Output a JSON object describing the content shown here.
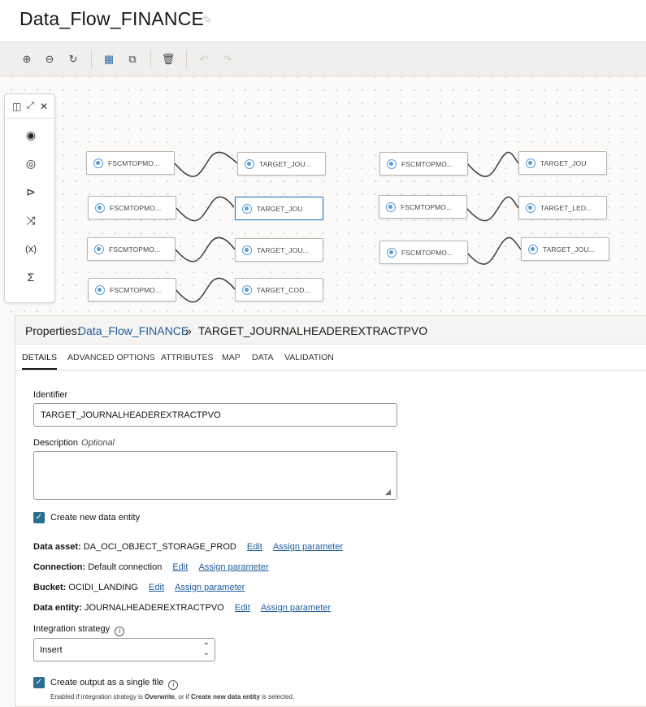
{
  "header": {
    "title": "Data_Flow_FINANCE",
    "edit_icon": "pencil-icon"
  },
  "toolbar": {
    "buttons": [
      {
        "name": "zoom-in-icon",
        "glyph": "⊕"
      },
      {
        "name": "zoom-out-icon",
        "glyph": "⊖"
      },
      {
        "name": "reset-icon",
        "glyph": "↻"
      },
      {
        "name": "grid-icon",
        "glyph": "▦"
      },
      {
        "name": "copy-icon",
        "glyph": "⧉"
      },
      {
        "name": "delete-icon",
        "glyph": "🗑"
      },
      {
        "name": "undo-icon",
        "glyph": "↶"
      },
      {
        "name": "redo-icon",
        "glyph": "↷"
      }
    ]
  },
  "palette": {
    "header_icons": [
      "panel-icon",
      "expand-icon",
      "close-icon"
    ],
    "items": [
      {
        "name": "source-operator-icon",
        "glyph": "◉"
      },
      {
        "name": "target-operator-icon",
        "glyph": "◎"
      },
      {
        "name": "filter-operator-icon",
        "glyph": "⊳"
      },
      {
        "name": "join-operator-icon",
        "glyph": "⤨"
      },
      {
        "name": "expression-operator-icon",
        "glyph": "(x)"
      },
      {
        "name": "aggregate-operator-icon",
        "glyph": "Σ"
      }
    ]
  },
  "canvas": {
    "nodes": [
      {
        "label": "FSCMTOPMO..."
      },
      {
        "label": "TARGET_JOU..."
      },
      {
        "label": "FSCMTOPMO..."
      },
      {
        "label": "TARGET_JOU"
      },
      {
        "label": "FSCMTOPMO..."
      },
      {
        "label": "TARGET_JOU..."
      },
      {
        "label": "FSCMTOPMO..."
      },
      {
        "label": "TARGET_COD..."
      },
      {
        "label": "FSCMTOPMO..."
      },
      {
        "label": "TARGET_JOU"
      },
      {
        "label": "FSCMTOPMO..."
      },
      {
        "label": "TARGET_LED..."
      },
      {
        "label": "FSCMTOPMO..."
      },
      {
        "label": "TARGET_JOU..."
      }
    ]
  },
  "properties": {
    "prefix": "Properties:",
    "flow_link": "Data_Flow_FINANCE",
    "separator": "»",
    "selected": "TARGET_JOURNALHEADEREXTRACTPVO",
    "tabs": [
      "DETAILS",
      "ADVANCED OPTIONS",
      "ATTRIBUTES",
      "MAP",
      "DATA",
      "VALIDATION"
    ],
    "active_tab": "DETAILS",
    "identifier_label": "Identifier",
    "identifier_value": "TARGET_JOURNALHEADEREXTRACTPVO",
    "description_label": "Description",
    "description_optional": "Optional",
    "description_value": "",
    "create_entity_label": "Create new data entity",
    "create_entity_checked": true,
    "data_asset_label": "Data asset:",
    "data_asset_value": "DA_OCI_OBJECT_STORAGE_PROD",
    "connection_label": "Connection:",
    "connection_value": "Default connection",
    "bucket_label": "Bucket:",
    "bucket_value": "OCIDI_LANDING",
    "data_entity_label": "Data entity:",
    "data_entity_value": "JOURNALHEADEREXTRACTPVO",
    "edit_label": "Edit",
    "assign_label": "Assign parameter",
    "strategy_label": "Integration strategy",
    "strategy_value": "Insert",
    "single_file_label": "Create output as a single file",
    "single_file_checked": true,
    "help_pre": "Enabled if integration strategy is ",
    "help_b1": "Overwrite",
    "help_mid": ", or if ",
    "help_b2": "Create new data entity",
    "help_post": " is selected."
  }
}
